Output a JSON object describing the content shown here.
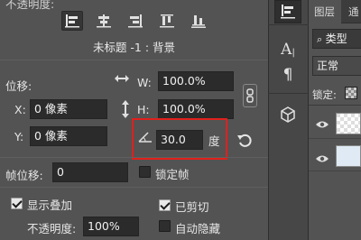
{
  "panel": {
    "fade_label": "不透明度:",
    "title": "未标题 -1 : 背景",
    "position_label": "位移:",
    "w_label": "W:",
    "w_value": "100.0%",
    "h_label": "H:",
    "h_value": "100.0%",
    "x_label": "X:",
    "x_value": "0 像素",
    "y_label": "Y:",
    "y_value": "0 像素",
    "angle_value": "30.0",
    "angle_unit": "度",
    "frame_offset_label": "帧位移:",
    "frame_offset_value": "0",
    "lock_frame_label": "锁定帧",
    "show_overlay_label": "显示叠加",
    "opacity_label": "不透明度:",
    "opacity_value": "100%",
    "clipped_label": "已剪切",
    "auto_hide_label": "自动隐藏",
    "checkboxes": {
      "lock_frame": false,
      "show_overlay": true,
      "clipped": true,
      "auto_hide": false
    },
    "highlight_color": "#e0201c"
  },
  "layers_panel": {
    "tab_layers": "图层",
    "tab_channels": "通",
    "search_label": "类型",
    "blend_mode": "正常",
    "lock_label": "锁定:"
  },
  "toolbar_icons": [
    "puppet-pin-icon",
    "character-icon",
    "paragraph-icon",
    "3d-icon"
  ],
  "colors": {
    "panel_bg": "#535353",
    "field_bg": "#2b2b2b",
    "highlight": "#e0201c"
  }
}
